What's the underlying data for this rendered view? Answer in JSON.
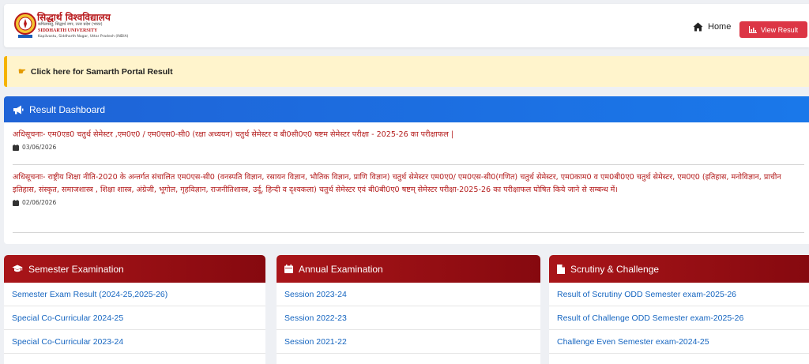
{
  "navbar": {
    "logo": {
      "hindi_name": "सिद्धार्थ विश्वविद्यालय",
      "hindi_address": "कपिलवस्तु, सिद्धार्थ नगर, उत्तर प्रदेश (भारत)",
      "english_name": "SIDDHARTH UNIVERSITY",
      "english_address": "Kapilvastu, Siddharth Nagar, Uttar Pradesh (INDIA)"
    },
    "home_label": "Home",
    "view_result_label": "View Result"
  },
  "notice": {
    "text": "Click here for Samarth Portal Result"
  },
  "dashboard": {
    "title": "Result Dashboard",
    "items": [
      {
        "text": "अधिसूचनाः- एम0एड0 चतुर्थ सेमेस्टर ,एम0ए0 / एम0एस0-सी0 (रक्षा अध्ययन) चतुर्थ सेमेस्टर व बी0सी0ए0 षष्टम सेमेस्टर परीक्षा - 2025-26 का परीक्षाफल |",
        "date": "03/06/2026"
      },
      {
        "text": "अधिसूचनाः- राष्ट्रीय शिक्षा नीति-2020 के अन्तर्गत संचालित एम0एस-सी0 (वनस्पति विज्ञान, रसायन विज्ञान, भौतिक विज्ञान, प्राणि विज्ञान) चतुर्थ सेमेस्टर एम0ए0/ एम0एस-सी0(गणित) चतुर्थ सेमेस्टर, एम0काम0 व एम0बी0ए0 चतुर्थ सेमेस्टर, एम0ए0 (इतिहास, मनोविज्ञान, प्राचीन इतिहास, संस्कृत, समाजशास्त्र , शिक्षा शास्त्र, अंग्रेजी, भूगोल, गृहविज्ञान, राजनीतिशास्त्र, उर्दू, हिन्दी व दृश्यकला) चतुर्थ सेमेस्टर एवं बी0बी0ए0 षष्टम् सेमेस्टर परीक्षा-2025-26 का परीक्षाफल घोषित किये जाने से सम्बन्ध में।",
        "date": "02/06/2026"
      }
    ]
  },
  "cards": [
    {
      "title": "Semester Examination",
      "icon": "graduation-cap-icon",
      "items": [
        "Semester Exam Result (2024-25,2025-26)",
        "Special Co-Curricular 2024-25",
        "Special Co-Curricular 2023-24"
      ]
    },
    {
      "title": "Annual Examination",
      "icon": "calendar-icon",
      "items": [
        "Session 2023-24",
        "Session 2022-23",
        "Session 2021-22"
      ]
    },
    {
      "title": "Scrutiny & Challenge",
      "icon": "file-icon",
      "items": [
        "Result of Scrutiny ODD Semester exam-2025-26",
        "Result of Challenge ODD Semester exam-2025-26",
        "Challenge Even Semester exam-2024-25"
      ]
    }
  ],
  "colors": {
    "dashboard_header": "#1f63d6",
    "card_header": "#a91519",
    "notice_bg": "#fff4cc",
    "news_text": "#b41d1d",
    "link": "#1565c0",
    "button": "#dc3545"
  }
}
